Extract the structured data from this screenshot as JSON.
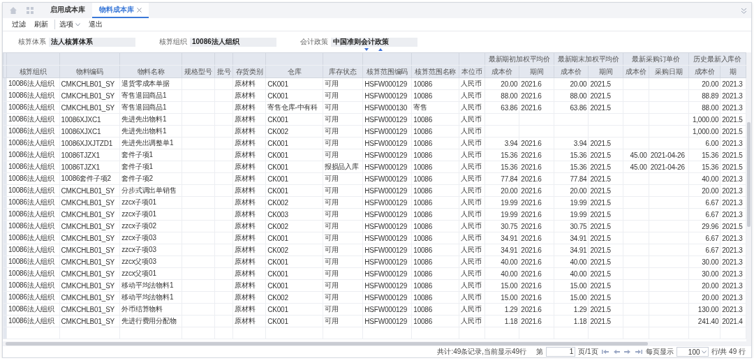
{
  "tabs": [
    {
      "label": "启用成本库",
      "selected": false,
      "closable": false
    },
    {
      "label": "物料成本库",
      "selected": true,
      "closable": true
    }
  ],
  "toolbar": [
    {
      "label": "过滤",
      "kind": "button"
    },
    {
      "label": "刷新",
      "kind": "button"
    },
    {
      "label": "选项",
      "kind": "dropdown"
    },
    {
      "label": "退出",
      "kind": "button"
    }
  ],
  "filters": [
    {
      "label": "核算体系",
      "value": "法人核算体系"
    },
    {
      "label": "核算组织",
      "value": "10086法人组织"
    },
    {
      "label": "会计政策",
      "value": "中国准则会计政策"
    }
  ],
  "table": {
    "header": [
      {
        "label": "核算组织"
      },
      {
        "label": "物料编码"
      },
      {
        "label": "物料名称"
      },
      {
        "label": "规格型号"
      },
      {
        "label": "批号"
      },
      {
        "label": "存货类别"
      },
      {
        "label": "仓库"
      },
      {
        "label": "库存状态"
      },
      {
        "label": "核算范围编码"
      },
      {
        "label": "核算范围名称"
      },
      {
        "label": "本位币"
      },
      {
        "group": "最新期初加权平均价",
        "columns": [
          {
            "label": "成本价",
            "kind": "amount"
          },
          {
            "label": "期间",
            "kind": "text"
          }
        ]
      },
      {
        "group": "最新期末加权平均价",
        "columns": [
          {
            "label": "成本价",
            "kind": "amount"
          },
          {
            "label": "期间",
            "kind": "text"
          }
        ]
      },
      {
        "group": "最新采购订单价",
        "columns": [
          {
            "label": "成本价",
            "kind": "amount"
          },
          {
            "label": "采购日期",
            "kind": "text"
          }
        ]
      },
      {
        "group": "历史最新入库价",
        "columns": [
          {
            "label": "成本价",
            "kind": "amount"
          },
          {
            "label": "期",
            "kind": "text"
          }
        ]
      }
    ],
    "rows": [
      [
        "10086法人组织",
        "CMKCHLB01_SY",
        "退货零成本单据",
        null,
        null,
        "原材料",
        "CK001",
        "可用",
        "HSFW000129",
        "10086",
        "人民币",
        "20.00",
        "2021.6",
        "20.00",
        "2021.5",
        null,
        null,
        "20.00",
        "2021.3"
      ],
      [
        "10086法人组织",
        "CMKCHLB01_SY",
        "寄售退回商品1",
        null,
        null,
        "原材料",
        "CK001",
        "可用",
        "HSFW000129",
        "10086",
        "人民币",
        "88.00",
        "2021.6",
        "88.00",
        "2021.5",
        null,
        null,
        "88.89",
        "2021.3"
      ],
      [
        "10086法人组织",
        "CMKCHLB01_SY",
        "寄售退回商品1",
        null,
        null,
        "原材料",
        "寄售仓库-中有科",
        "可用",
        "HSFW000130",
        "寄售",
        "人民币",
        "63.86",
        "2021.6",
        "63.86",
        "2021.5",
        null,
        null,
        "88.00",
        "2021.3"
      ],
      [
        "10086法人组织",
        "10086XJXC1",
        "先进先出物料1",
        null,
        null,
        "原材料",
        "CK001",
        "可用",
        "HSFW000129",
        "10086",
        "人民币",
        null,
        null,
        null,
        null,
        null,
        null,
        "1,000.00",
        "2021.5"
      ],
      [
        "10086法人组织",
        "10086XJXC1",
        "先进先出物料1",
        null,
        null,
        "原材料",
        "CK002",
        "可用",
        "HSFW000129",
        "10086",
        "人民币",
        null,
        null,
        null,
        null,
        null,
        null,
        "1,000.00",
        "2021.5"
      ],
      [
        "10086法人组织",
        "10086XJXJTZD1",
        "先进先出调整单1",
        null,
        null,
        "原材料",
        "CK001",
        "可用",
        "HSFW000129",
        "10086",
        "人民币",
        "3.94",
        "2021.6",
        "3.94",
        "2021.5",
        null,
        null,
        "6.00",
        "2021.3"
      ],
      [
        "10086法人组织",
        "10086TJZX1",
        "套件子项1",
        null,
        null,
        "原材料",
        "CK001",
        "可用",
        "HSFW000129",
        "10086",
        "人民币",
        "15.36",
        "2021.6",
        "15.36",
        "2021.5",
        "45.00",
        "2021-04-26",
        "15.36",
        "2021.5"
      ],
      [
        "10086法人组织",
        "10086TJZX1",
        "套件子项1",
        null,
        null,
        "原材料",
        "CK001",
        "报损品入库",
        "HSFW000129",
        "10086",
        "人民币",
        "15.36",
        "2021.6",
        "15.36",
        "2021.5",
        "45.00",
        "2021-04-26",
        "15.36",
        "2021.5"
      ],
      [
        "10086法人组织",
        "10086套件子项2",
        "套件子项2",
        null,
        null,
        "原材料",
        "CK001",
        "可用",
        "HSFW000129",
        "10086",
        "人民币",
        "77.84",
        "2021.6",
        "77.84",
        "2021.5",
        null,
        null,
        "40.00",
        "2021.3"
      ],
      [
        "10086法人组织",
        "CMKCHLB01_SY",
        "分步式调出单销售",
        null,
        null,
        "原材料",
        "CK001",
        "可用",
        "HSFW000129",
        "10086",
        "人民币",
        "20.00",
        "2021.6",
        "20.00",
        "2021.5",
        null,
        null,
        "20.00",
        "2021.3"
      ],
      [
        "10086法人组织",
        "CMKCHLB01_SY",
        "zzcx子项01",
        null,
        null,
        "原材料",
        "CK002",
        "可用",
        "HSFW000129",
        "10086",
        "人民币",
        "19.99",
        "2021.6",
        "19.99",
        "2021.5",
        null,
        null,
        "6.67",
        "2021.3"
      ],
      [
        "10086法人组织",
        "CMKCHLB01_SY",
        "zzcx子项01",
        null,
        null,
        "原材料",
        "CK003",
        "可用",
        "HSFW000129",
        "10086",
        "人民币",
        "19.99",
        "2021.6",
        "19.99",
        "2021.5",
        null,
        null,
        "6.67",
        "2021.3"
      ],
      [
        "10086法人组织",
        "CMKCHLB01_SY",
        "zzcx子项02",
        null,
        null,
        "原材料",
        "CK002",
        "可用",
        "HSFW000129",
        "10086",
        "人民币",
        "30.75",
        "2021.6",
        "30.75",
        "2021.5",
        null,
        null,
        "29.96",
        "2021.5"
      ],
      [
        "10086法人组织",
        "CMKCHLB01_SY",
        "zzcx子项03",
        null,
        null,
        "原材料",
        "CK001",
        "可用",
        "HSFW000129",
        "10086",
        "人民币",
        "34.91",
        "2021.6",
        "34.91",
        "2021.5",
        null,
        null,
        "6.67",
        "2021.3"
      ],
      [
        "10086法人组织",
        "CMKCHLB01_SY",
        "zzcx子项03",
        null,
        null,
        "原材料",
        "CK002",
        "可用",
        "HSFW000129",
        "10086",
        "人民币",
        "34.91",
        "2021.6",
        "34.91",
        "2021.5",
        null,
        null,
        "6.67",
        "2021.3"
      ],
      [
        "10086法人组织",
        "CMKCHLB01_SY",
        "zzcx父项03",
        null,
        null,
        "原材料",
        "CK001",
        "可用",
        "HSFW000129",
        "10086",
        "人民币",
        "40.00",
        "2021.6",
        "40.00",
        "2021.5",
        null,
        null,
        "30.00",
        "2021.3"
      ],
      [
        "10086法人组织",
        "CMKCHLB01_SY",
        "zzcx父项01",
        null,
        null,
        "原材料",
        "CK001",
        "可用",
        "HSFW000129",
        "10086",
        "人民币",
        "40.00",
        "2021.6",
        "40.00",
        "2021.5",
        null,
        null,
        "30.00",
        "2021.3"
      ],
      [
        "10086法人组织",
        "CMKCHLB01_SY",
        "移动平均法物料1",
        null,
        null,
        "原材料",
        "CK001",
        "可用",
        "HSFW000129",
        "10086",
        "人民币",
        "15.00",
        "2021.6",
        "15.00",
        "2021.5",
        null,
        null,
        "20.00",
        "2021.3"
      ],
      [
        "10086法人组织",
        "CMKCHLB01_SY",
        "移动平均法物料1",
        null,
        null,
        "原材料",
        "CK002",
        "可用",
        "HSFW000129",
        "10086",
        "人民币",
        "15.00",
        "2021.6",
        "15.00",
        "2021.5",
        null,
        null,
        "20.00",
        "2021.3"
      ],
      [
        "10086法人组织",
        "CMKCHLB01_SY",
        "外币结算物料",
        null,
        null,
        "原材料",
        "CK001",
        "可用",
        "HSFW000129",
        "10086",
        "人民币",
        "1.29",
        "2021.6",
        "1.29",
        "2021.5",
        null,
        null,
        "130.00",
        "2021.3"
      ],
      [
        "10086法人组织",
        "CMKCHLB01_SY",
        "先进行费用分配物",
        null,
        null,
        "原材料",
        "CK001",
        "可用",
        "HSFW000129",
        "10086",
        "人民币",
        "1.18",
        "2021.6",
        "1.18",
        "2021.5",
        null,
        null,
        "241.40",
        "2021.4"
      ]
    ]
  },
  "footer": {
    "summary": "共计:49条记录,当前显示49行",
    "page_prefix": "第",
    "page": "1",
    "page_suffix": "页/1页",
    "per_page_label": "每页显示",
    "per_page": "100",
    "total": "行/共 49 行"
  }
}
